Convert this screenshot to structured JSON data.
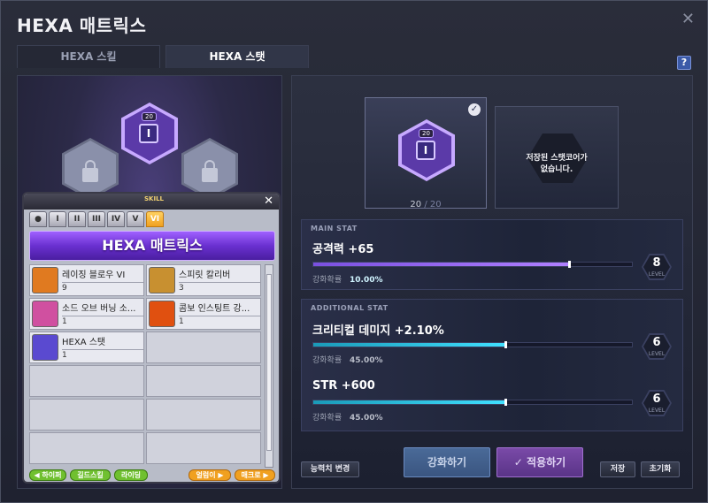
{
  "window": {
    "title": "HEXA 매트릭스",
    "help_label": "?"
  },
  "tabs": [
    {
      "label": "HEXA 스킬",
      "active": false
    },
    {
      "label": "HEXA 스탯",
      "active": true
    }
  ],
  "matrix": {
    "center_core_level": "20"
  },
  "skill_popup": {
    "tag": "SKILL",
    "tabs": [
      "●",
      "I",
      "II",
      "III",
      "IV",
      "V",
      "VI"
    ],
    "selected_tab": "VI",
    "banner": "HEXA 매트릭스",
    "skills": [
      {
        "name": "레이징 블로우 VI",
        "level": "9",
        "icon_color": "#e07a20"
      },
      {
        "name": "스피릿 칼리버",
        "level": "3",
        "icon_color": "#c89030"
      },
      {
        "name": "소드 오브 버닝 소...",
        "level": "1",
        "icon_color": "#d050a0"
      },
      {
        "name": "콤보 인스팅트 강...",
        "level": "1",
        "icon_color": "#e05010"
      },
      {
        "name": "HEXA 스탯",
        "level": "1",
        "icon_color": "#5a4ad0"
      }
    ],
    "buttons": {
      "beginner": "◀ 하이퍼",
      "guild": "길드스킬",
      "riding": "라이딩",
      "hyper": "얼럼이 ▶",
      "macro": "매크로 ▶"
    }
  },
  "core": {
    "level": "20",
    "count": "20",
    "count_max": "20",
    "separator": "/",
    "saved_text_line1": "저장된 스탯코어가",
    "saved_text_line2": "없습니다."
  },
  "main_stat": {
    "header": "MAIN STAT",
    "name": "공격력",
    "value": "+65",
    "prob_label": "강화확률",
    "prob_value": "10.00%",
    "level": "8",
    "level_label": "LEVEL",
    "progress": 0.8
  },
  "additional_stat": {
    "header": "ADDITIONAL STAT",
    "items": [
      {
        "name": "크리티컬 데미지",
        "value": "+2.10%",
        "prob_label": "강화확률",
        "prob_value": "45.00%",
        "level": "6",
        "level_label": "LEVEL",
        "progress": 0.6
      },
      {
        "name": "STR",
        "value": "+600",
        "prob_label": "강화확률",
        "prob_value": "45.00%",
        "level": "6",
        "level_label": "LEVEL",
        "progress": 0.6
      }
    ]
  },
  "buttons": {
    "change_ability": "능력치 변경",
    "enhance": "강화하기",
    "apply": "적용하기",
    "save": "저장",
    "reset": "초기화"
  },
  "colors": {
    "accent_purple": "#a070ff",
    "accent_cyan": "#40e0ff"
  }
}
